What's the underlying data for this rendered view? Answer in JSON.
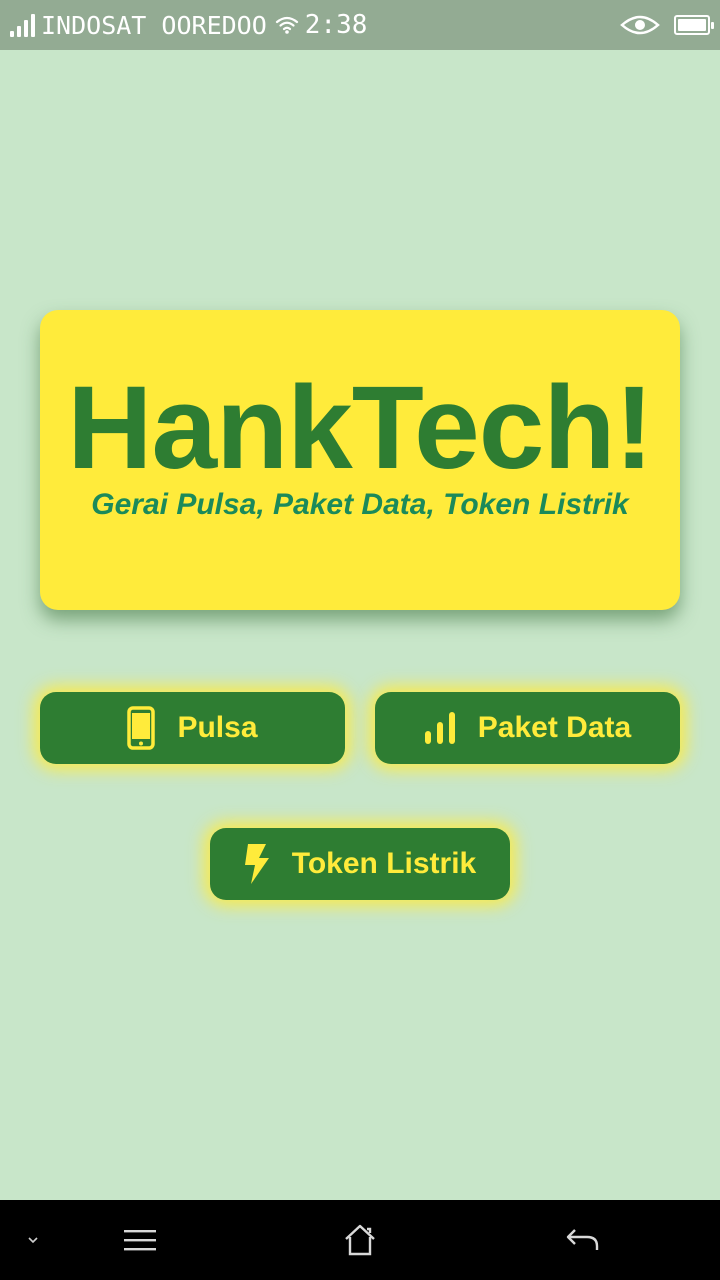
{
  "status_bar": {
    "carrier": "INDOSAT OOREDOO",
    "time": "2:38",
    "icons": [
      "signal-icon",
      "wifi-icon",
      "eye-icon",
      "battery-icon"
    ]
  },
  "hero": {
    "title": "HankTech!",
    "subtitle": "Gerai Pulsa, Paket Data, Token Listrik"
  },
  "buttons": {
    "pulsa": {
      "label": "Pulsa",
      "icon": "phone-icon"
    },
    "paket_data": {
      "label": "Paket Data",
      "icon": "signal-bars-icon"
    },
    "token_listrik": {
      "label": "Token Listrik",
      "icon": "lightning-icon"
    }
  },
  "nav_bar": {
    "icons": [
      "chevron-down-icon",
      "menu-icon",
      "home-icon",
      "back-icon"
    ]
  },
  "colors": {
    "background": "#c8e6c9",
    "status_bar": "#93ab93",
    "card": "#ffeb3b",
    "primary_green": "#2e7d32",
    "subtitle_green": "#1b8a5a",
    "button_text": "#ffeb3b"
  }
}
